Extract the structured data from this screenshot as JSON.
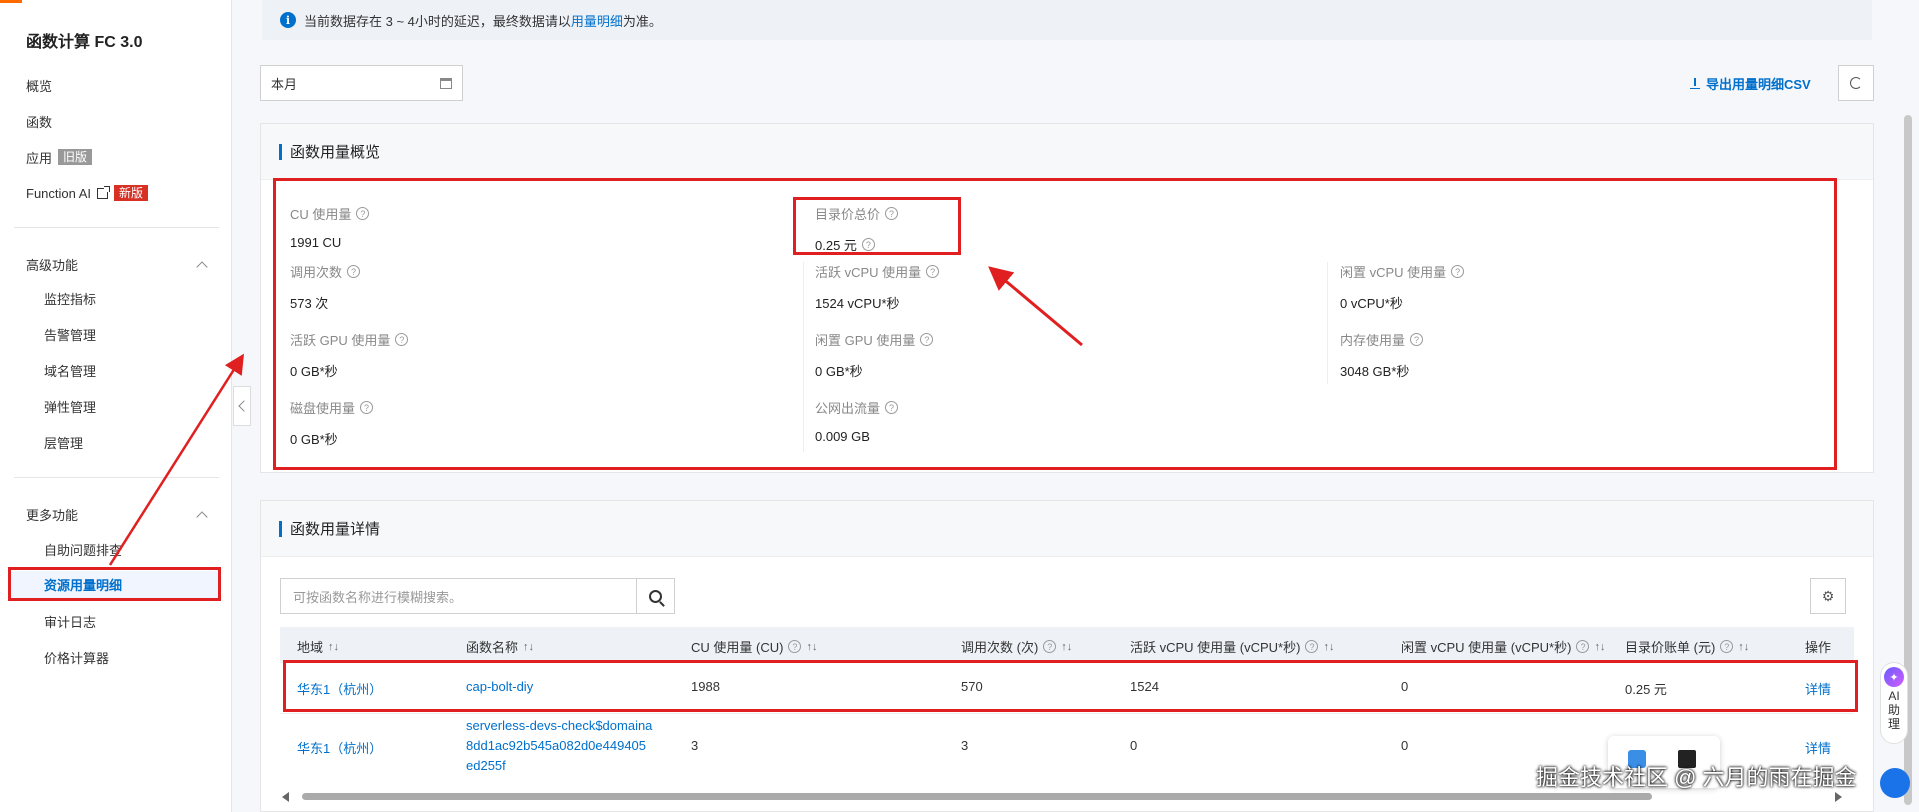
{
  "sidebar": {
    "title": "函数计算 FC 3.0",
    "items": [
      {
        "label": "概览"
      },
      {
        "label": "函数"
      },
      {
        "label": "应用",
        "tag": "旧版"
      },
      {
        "label": "Function AI",
        "tag": "新版"
      }
    ],
    "advanced": {
      "title": "高级功能",
      "items": [
        "监控指标",
        "告警管理",
        "域名管理",
        "弹性管理",
        "层管理"
      ]
    },
    "more": {
      "title": "更多功能",
      "items": [
        "自助问题排查",
        "资源用量明细",
        "审计日志",
        "价格计算器"
      ],
      "active_index": 1
    }
  },
  "notice": {
    "text_before": "当前数据存在 3 ~ 4小时的延迟，最终数据请以",
    "link": "用量明细",
    "text_after": "为准。"
  },
  "toolbar": {
    "date_value": "本月",
    "export_label": "导出用量明细CSV"
  },
  "overview": {
    "title": "函数用量概览",
    "metrics": [
      {
        "label": "CU 使用量",
        "value": "1991 CU"
      },
      {
        "label": "目录价总价",
        "value": "0.25 元"
      },
      {
        "label": "调用次数",
        "value": "573 次"
      },
      {
        "label": "活跃 vCPU 使用量",
        "value": "1524 vCPU*秒"
      },
      {
        "label": "闲置 vCPU 使用量",
        "value": "0 vCPU*秒"
      },
      {
        "label": "活跃 GPU 使用量",
        "value": "0 GB*秒"
      },
      {
        "label": "闲置 GPU 使用量",
        "value": "0 GB*秒"
      },
      {
        "label": "内存使用量",
        "value": "3048 GB*秒"
      },
      {
        "label": "磁盘使用量",
        "value": "0 GB*秒"
      },
      {
        "label": "公网出流量",
        "value": "0.009 GB"
      }
    ]
  },
  "details": {
    "title": "函数用量详情",
    "search_placeholder": "可按函数名称进行模糊搜索。",
    "columns": [
      "地域",
      "函数名称",
      "CU 使用量 (CU)",
      "调用次数 (次)",
      "活跃 vCPU 使用量 (vCPU*秒)",
      "闲置 vCPU 使用量 (vCPU*秒)",
      "目录价账单 (元)",
      "操作"
    ],
    "rows": [
      {
        "region": "华东1（杭州）",
        "name_lines": [
          "cap-bolt-diy"
        ],
        "cu": "1988",
        "calls": "570",
        "active_vcpu": "1524",
        "idle_vcpu": "0",
        "price": "0.25 元",
        "action": "详情"
      },
      {
        "region": "华东1（杭州）",
        "name_lines": [
          "serverless-devs-check$domaina",
          "8dd1ac92b545a082d0e449405",
          "ed255f"
        ],
        "cu": "3",
        "calls": "3",
        "active_vcpu": "0",
        "idle_vcpu": "0",
        "price": "",
        "action": "详情"
      }
    ]
  },
  "assistant": {
    "line1": "AI",
    "line2": "助",
    "line3": "理"
  },
  "watermark": "掘金技术社区 @ 六月的雨在掘金"
}
